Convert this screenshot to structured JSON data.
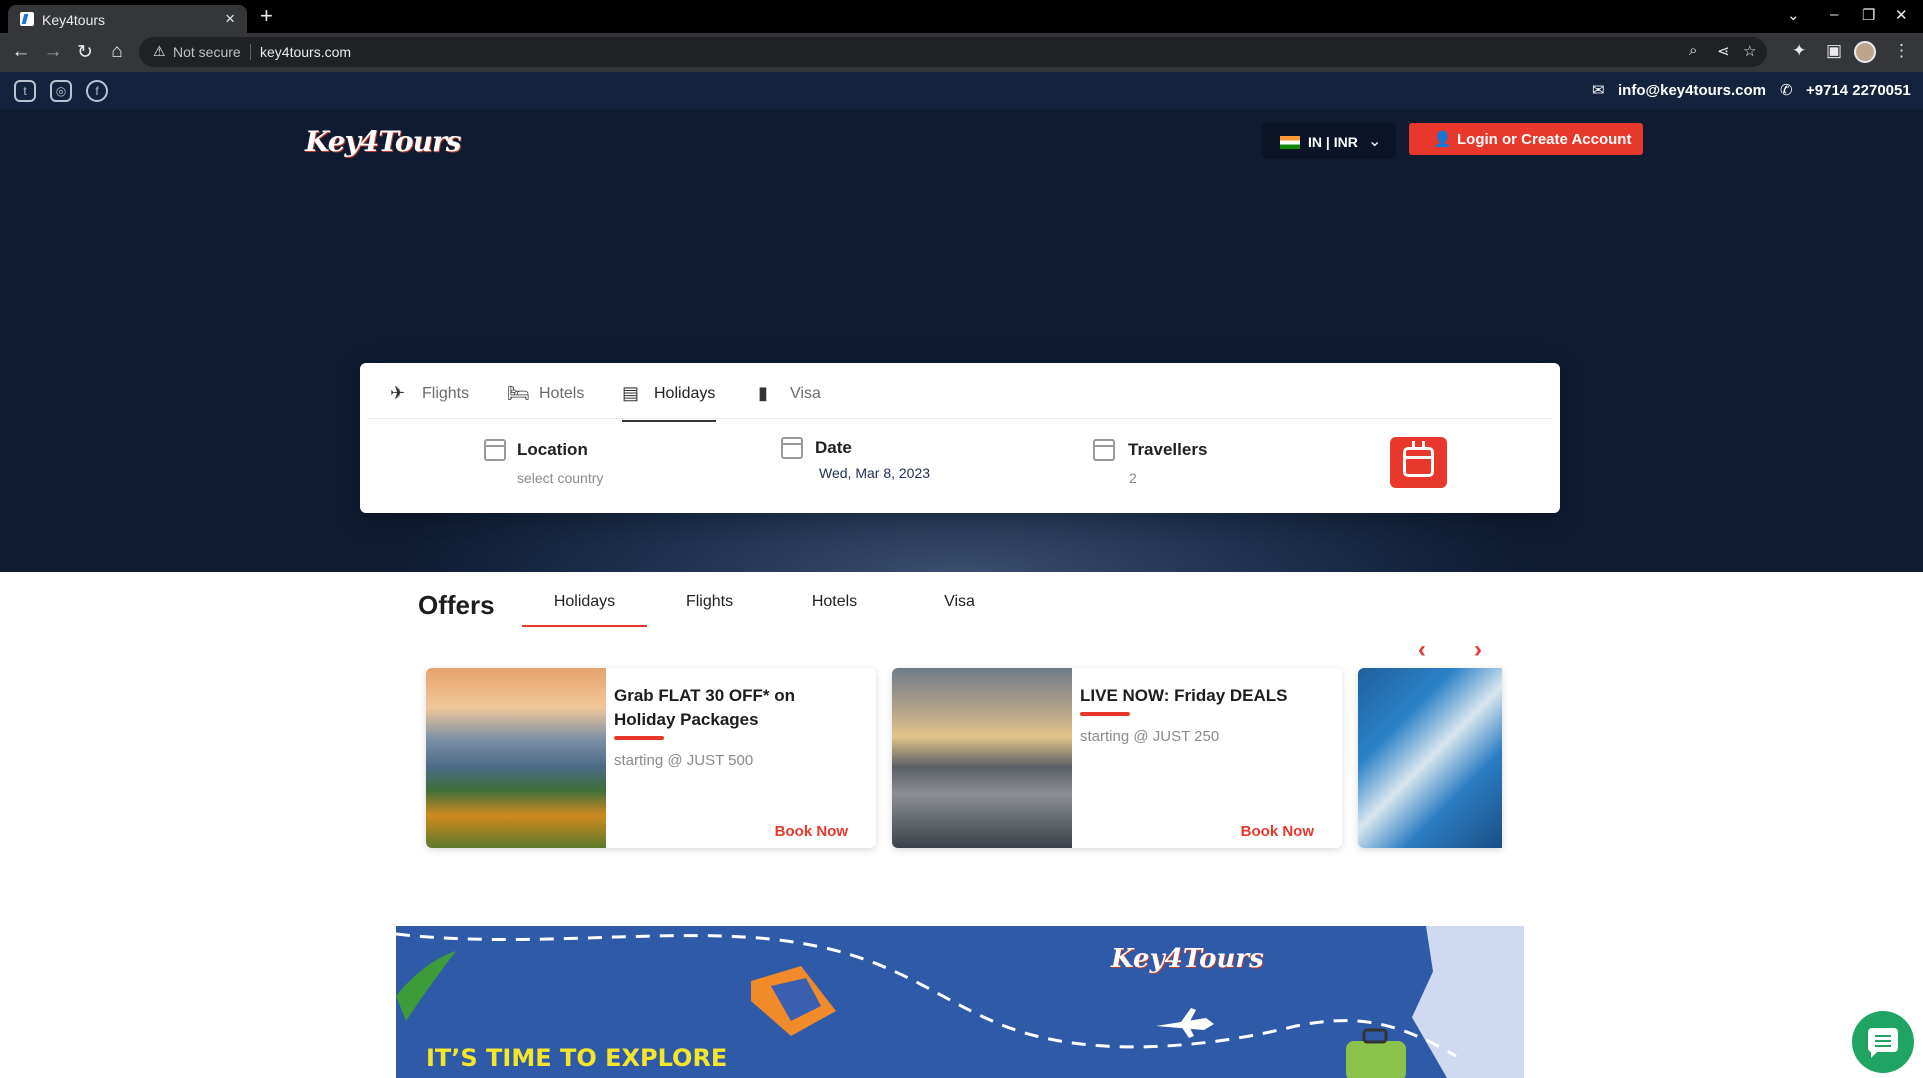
{
  "browser": {
    "tab_title": "Key4tours",
    "new_tab": "+",
    "close_tab": "×",
    "security": "Not secure",
    "url": "key4tours.com"
  },
  "topbar": {
    "socials": [
      "twitter",
      "instagram",
      "facebook"
    ],
    "email": "info@key4tours.com",
    "phone": "+9714 2270051"
  },
  "header": {
    "logo_text": "Key4Tours",
    "currency": "IN | INR",
    "login_label": "Login or Create Account"
  },
  "search": {
    "tabs": [
      {
        "label": "Flights",
        "icon": "airplane-icon"
      },
      {
        "label": "Hotels",
        "icon": "bed-icon"
      },
      {
        "label": "Holidays",
        "icon": "holiday-icon",
        "active": true
      },
      {
        "label": "Visa",
        "icon": "passport-icon"
      }
    ],
    "location": {
      "title": "Location",
      "value": "select country"
    },
    "date": {
      "title": "Date",
      "value": "Wed, Mar 8, 2023"
    },
    "travellers": {
      "title": "Travellers",
      "value": "2"
    }
  },
  "offers": {
    "title": "Offers",
    "tabs": [
      "Holidays",
      "Flights",
      "Hotels",
      "Visa"
    ],
    "active_tab": "Holidays",
    "cards": [
      {
        "title": "Grab FLAT 30 OFF* on Holiday Packages",
        "price": "starting @ JUST 500",
        "cta": "Book Now"
      },
      {
        "title": "LIVE NOW: Friday DEALS",
        "price": "starting @ JUST 250",
        "cta": "Book Now"
      }
    ]
  },
  "banner": {
    "logo_text": "Key4Tours",
    "cta": "IT’S TIME TO EXPLORE"
  },
  "colors": {
    "accent": "#e8382c",
    "hero_bg": "#0e1b31",
    "chat": "#1fa463"
  }
}
